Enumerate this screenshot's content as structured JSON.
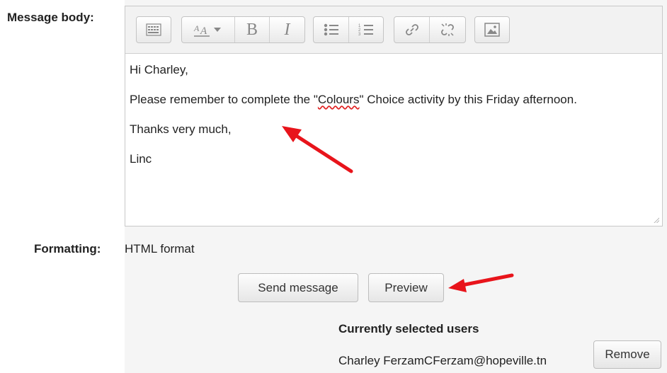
{
  "form": {
    "message_body_label": "Message body:",
    "formatting_label": "Formatting:",
    "formatting_value": "HTML format"
  },
  "toolbar": {
    "buttons": [
      {
        "name": "show-more-buttons",
        "icon": "toolbar-toggle-icon"
      },
      {
        "name": "font-style",
        "icon": "font-style-icon"
      },
      {
        "name": "bold",
        "glyph": "B",
        "icon": "bold-icon"
      },
      {
        "name": "italic",
        "glyph": "I",
        "icon": "italic-icon"
      },
      {
        "name": "unordered-list",
        "icon": "bullet-list-icon"
      },
      {
        "name": "ordered-list",
        "icon": "numbered-list-icon"
      },
      {
        "name": "link",
        "icon": "link-icon"
      },
      {
        "name": "unlink",
        "icon": "unlink-icon"
      },
      {
        "name": "image",
        "icon": "image-icon"
      }
    ]
  },
  "editor": {
    "greeting": "Hi Charley,",
    "body_before": "Please remember to complete the \"",
    "body_highlight": "Colours",
    "body_after": "\" Choice activity by this Friday afternoon.",
    "signoff": "Thanks very much,",
    "signature": "Linc"
  },
  "actions": {
    "send_label": "Send message",
    "preview_label": "Preview"
  },
  "selected_users": {
    "heading": "Currently selected users",
    "users": [
      {
        "name": "Charley Ferzam",
        "email": "CFerzam@hopeville.tn",
        "remove_label": "Remove"
      }
    ]
  },
  "annotation": {
    "arrow_color": "#e8141b"
  }
}
